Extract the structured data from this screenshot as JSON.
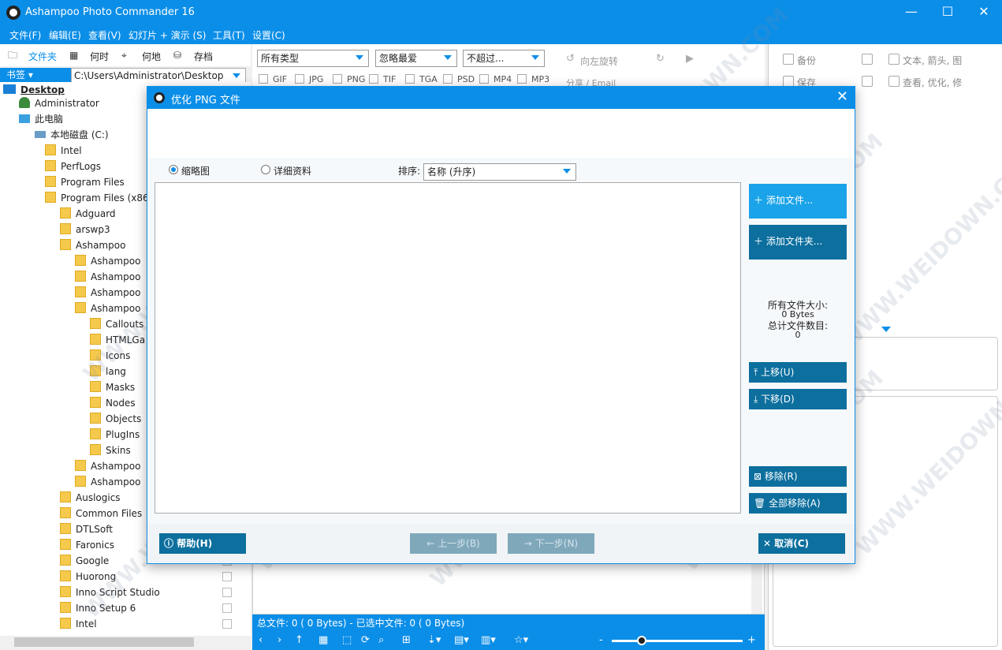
{
  "app": {
    "title": "Ashampoo Photo Commander 16"
  },
  "menu": [
    "文件(F)",
    "编辑(E)",
    "查看(V)",
    "幻灯片 + 演示 (S)",
    "工具(T)",
    "设置(C)"
  ],
  "nav_tabs": [
    "文件夹",
    "何时",
    "何地",
    "存档"
  ],
  "bookmark_label": "书签",
  "path_value": "C:\\Users\\Administrator\\Desktop",
  "tree": {
    "desktop": "Desktop",
    "admin": "Administrator",
    "pc": "此电脑",
    "disk": "本地磁盘 (C:)",
    "items": [
      "Intel",
      "PerfLogs",
      "Program Files",
      "Program Files (x86)",
      "Adguard",
      "arswp3",
      "Ashampoo",
      "Ashampoo",
      "Ashampoo",
      "Ashampoo",
      "Ashampoo",
      "Callouts",
      "HTMLGa",
      "Icons",
      "lang",
      "Masks",
      "Nodes",
      "Objects",
      "PlugIns",
      "Skins",
      "Ashampoo",
      "Ashampoo",
      "Auslogics",
      "Common Files",
      "DTLSoft",
      "Faronics",
      "Google",
      "Huorong",
      "Inno Script Studio",
      "Inno Setup 6",
      "Intel"
    ]
  },
  "filters": {
    "type": "所有类型",
    "fav": "忽略最爱",
    "limit": "不超过...",
    "exts": [
      "GIF",
      "JPG",
      "PNG",
      "TIF",
      "TGA",
      "PSD",
      "MP4",
      "MP3"
    ]
  },
  "toolbar_top": {
    "rotate_left": "向左旋转",
    "share": "分享 / Email"
  },
  "right_panel": {
    "backup": "备份",
    "save": "保存",
    "text_arrows": "文本, 箭头, 图",
    "view_optimize": "查看, 优化, 修"
  },
  "status": {
    "text": "总文件: 0 (    0 Bytes) - 已选中文件: 0 (    0 Bytes)"
  },
  "dialog": {
    "title": "优化 PNG 文件",
    "view_thumbs": "缩略图",
    "view_details": "详细资料",
    "sort_label": "排序:",
    "sort_value": "名称 (升序)",
    "add_files": "添加文件...",
    "add_folder": "添加文件夹...",
    "total_size_label": "所有文件大小:",
    "total_size_value": "0 Bytes",
    "total_count_label": "总计文件数目:",
    "total_count_value": "0",
    "move_up": "上移(U)",
    "move_down": "下移(D)",
    "remove": "移除(R)",
    "remove_all": "全部移除(A)",
    "help": "帮助(H)",
    "prev": "← 上一步(B)",
    "next": "→ 下一步(N)",
    "cancel": "取消(C)"
  },
  "watermark": "WWW.WEIDOWN.COM",
  "colors": {
    "accent": "#0b8ee8",
    "dark_button": "#0c6f9e",
    "light_button": "#1aa3e8"
  }
}
